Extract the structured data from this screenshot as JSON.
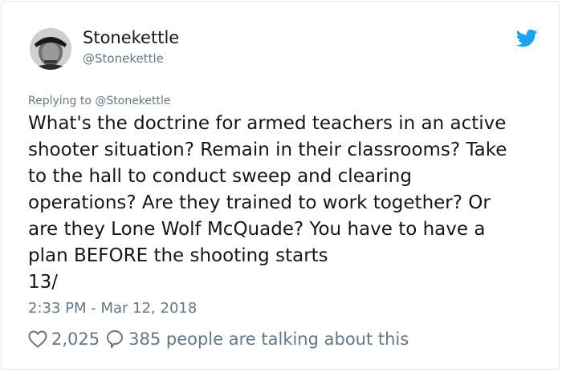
{
  "tweet": {
    "avatar_icon": "user-avatar-photo",
    "display_name": "Stonekettle",
    "handle": "@Stonekettle",
    "brand_icon": "twitter-bird-icon",
    "brand_color": "#1da1f2",
    "replying_to": "Replying to @Stonekettle",
    "text_lines": [
      "What's the doctrine for armed teachers in an active",
      "shooter situation? Remain in their classrooms? Take",
      "to the hall to conduct sweep and clearing",
      "operations? Are they trained to work together? Or",
      "are they Lone Wolf McQuade? You have to have a",
      "plan BEFORE the shooting starts",
      "13/"
    ],
    "timestamp": "2:33 PM - Mar 12, 2018",
    "likes": "2,025",
    "like_icon": "heart-icon",
    "reply_icon": "comment-bubble-icon",
    "talking_text": "385 people are talking about this"
  }
}
